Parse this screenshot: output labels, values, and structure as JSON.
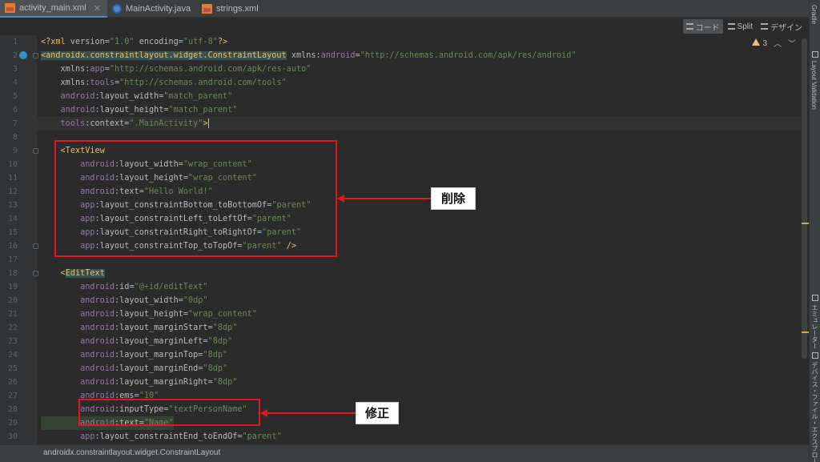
{
  "tabs": [
    {
      "label": "activity_main.xml",
      "icon": "xml-file-icon",
      "active": true
    },
    {
      "label": "MainActivity.java",
      "icon": "java-class-icon",
      "active": false
    },
    {
      "label": "strings.xml",
      "icon": "xml-file-icon",
      "active": false
    }
  ],
  "view_modes": {
    "code": "コード",
    "split": "Split",
    "design": "デザイン"
  },
  "inspection": {
    "warnings": "3"
  },
  "line_numbers": [
    "1",
    "2",
    "3",
    "4",
    "5",
    "6",
    "7",
    "8",
    "9",
    "10",
    "11",
    "12",
    "13",
    "14",
    "15",
    "16",
    "17",
    "18",
    "19",
    "20",
    "21",
    "22",
    "23",
    "24",
    "25",
    "26",
    "27",
    "28",
    "29",
    "30"
  ],
  "right_tools": {
    "gradle": "Gradle",
    "layout_validation": "Layout Validation",
    "emulator": "エミュレーター",
    "device_explorer": "デバイス・ファイル・エクスプローラー"
  },
  "status": {
    "breadcrumb": "androidx.constraintlayout.widget.ConstraintLayout"
  },
  "annotations": {
    "delete": "削除",
    "modify": "修正"
  },
  "colors": {
    "annotation_red": "#e0191f",
    "tag": "#e8bf6a",
    "namespace": "#9876aa",
    "string": "#6a8759"
  }
}
